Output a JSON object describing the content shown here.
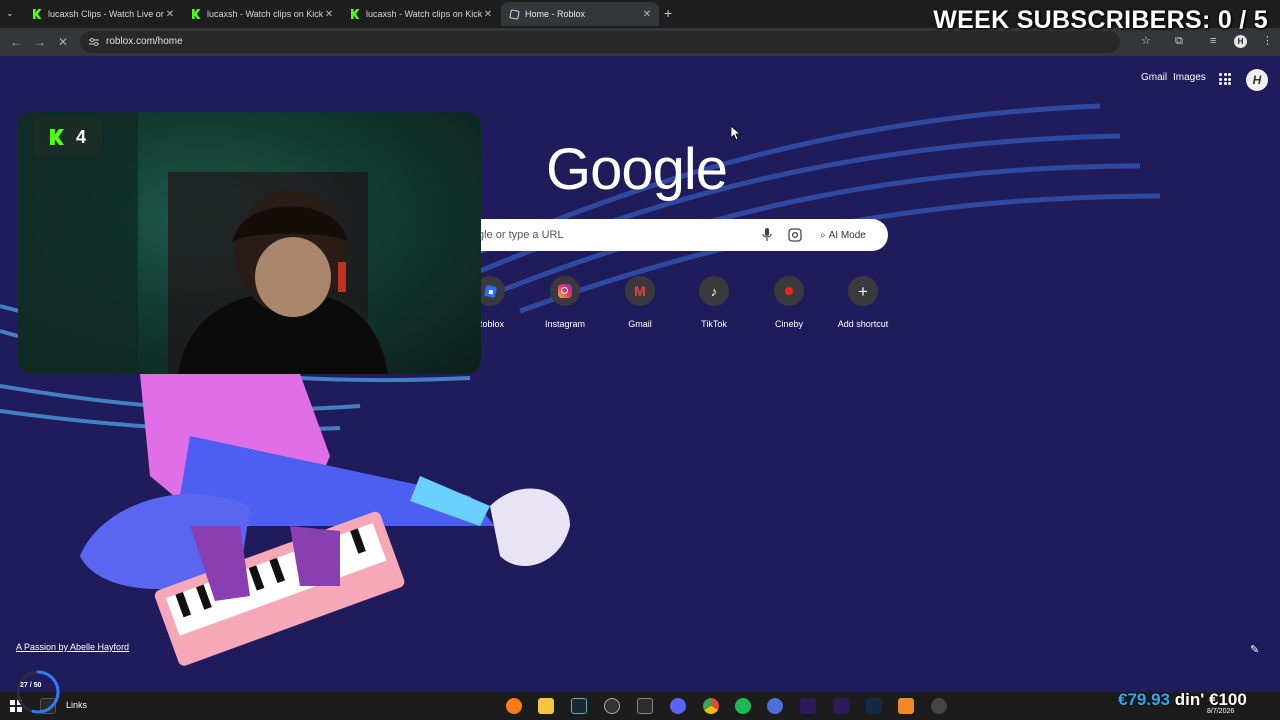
{
  "browser": {
    "tabs": [
      {
        "title": "lucaxsh Clips - Watch Live on Kick",
        "icon": "kick-icon",
        "active": false
      },
      {
        "title": "lucaxsh - Watch clips on Kick",
        "icon": "kick-icon",
        "active": false
      },
      {
        "title": "lucaxsh - Watch clips on Kick",
        "icon": "kick-icon",
        "active": false
      },
      {
        "title": "Home - Roblox",
        "icon": "roblox-icon",
        "active": true
      }
    ],
    "url": "roblox.com/home"
  },
  "overlay": {
    "subs_label": "WEEK SUBSCRIBERS: 0 / 5",
    "cam_count": "4"
  },
  "ntp": {
    "header_links": {
      "gmail": "Gmail",
      "images": "Images"
    },
    "profile_initial": "H",
    "logo": "Google",
    "search_placeholder": "gle or type a URL",
    "ai_mode_label": "AI Mode",
    "shortcuts": [
      {
        "label": "Roblox",
        "icon": "roblox-icon"
      },
      {
        "label": "Instagram",
        "icon": "instagram-icon"
      },
      {
        "label": "Gmail",
        "icon": "gmail-icon"
      },
      {
        "label": "TikTok",
        "icon": "tiktok-icon"
      },
      {
        "label": "Cineby",
        "icon": "cineby-icon"
      },
      {
        "label": "Add shortcut",
        "icon": "plus-icon"
      }
    ],
    "art_credit": "A Passion by Abelle Hayford",
    "gmail_letter": "M",
    "tiktok_glyph": "♪",
    "plus_glyph": "+"
  },
  "taskbar": {
    "links_label": "Links",
    "money_a": "€79.93",
    "money_b": "din' €100",
    "date": "8/7/2026",
    "progress_counter": "27 / 50",
    "progress": 0.54
  },
  "colors": {
    "kick_green": "#53fc18",
    "ntp_bg": "#201c5c",
    "accent_blue": "#2aa8ff"
  }
}
